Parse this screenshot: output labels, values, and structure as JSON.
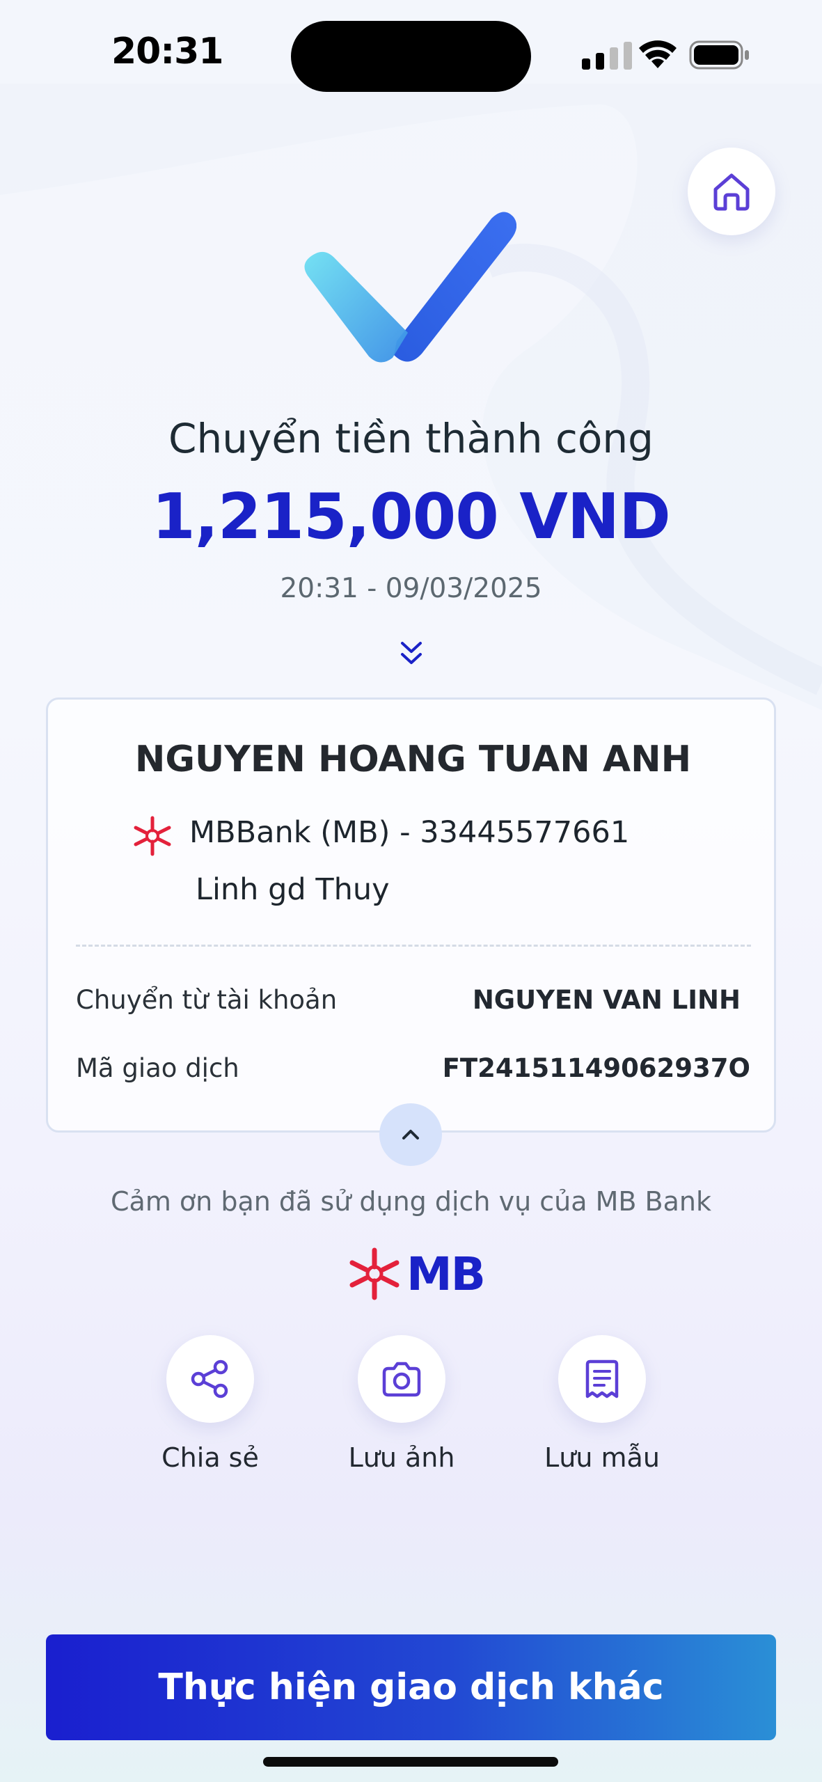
{
  "status_bar": {
    "time": "20:31"
  },
  "header": {
    "home_icon": "home-icon",
    "success_icon": "check-icon"
  },
  "result": {
    "title": "Chuyển tiền thành công",
    "amount": "1,215,000 VND",
    "datetime": "20:31 - 09/03/2025"
  },
  "detail": {
    "recipient_name": "NGUYEN HOANG TUAN ANH",
    "bank_line": "MBBank (MB) - 33445577661",
    "note": "Linh gd Thuy",
    "rows": [
      {
        "label": "Chuyển từ tài khoản",
        "value": "NGUYEN VAN LINH"
      },
      {
        "label": "Mã giao dịch",
        "value": "FT24151149062937O"
      }
    ]
  },
  "footer": {
    "thanks": "Cảm ơn bạn đã sử dụng dịch vụ của MB Bank",
    "brand": "MB"
  },
  "actions": [
    {
      "label": "Chia sẻ",
      "icon": "share-icon"
    },
    {
      "label": "Lưu ảnh",
      "icon": "camera-icon"
    },
    {
      "label": "Lưu mẫu",
      "icon": "receipt-icon"
    }
  ],
  "primary_button": {
    "label": "Thực hiện giao dịch khác"
  },
  "colors": {
    "accent": "#1a22c7",
    "brand_red": "#e3213b",
    "icon_purple": "#5b3fd6"
  }
}
